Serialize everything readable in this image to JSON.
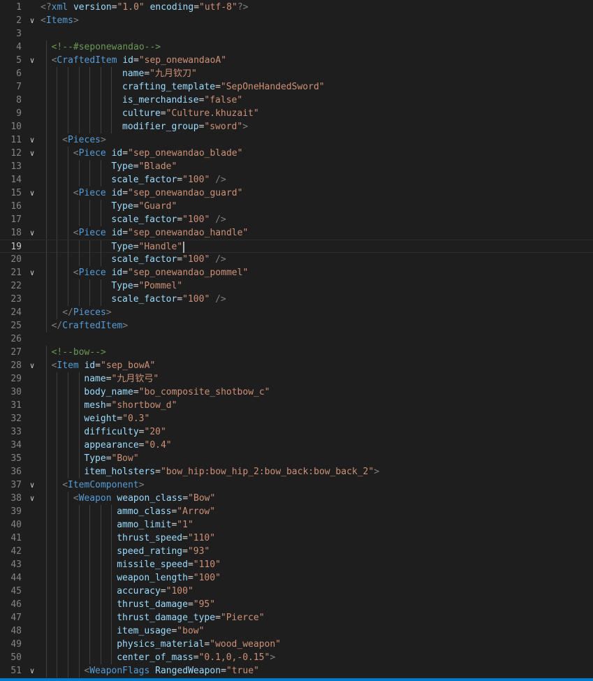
{
  "editor": {
    "current_line": 19,
    "colors": {
      "background": "#1e1e1e",
      "tag": "#569cd6",
      "bracket": "#808080",
      "attribute": "#9cdcfe",
      "string": "#ce9178",
      "comment": "#6a9955",
      "text": "#d4d4d4",
      "status_bar": "#007acc"
    },
    "lines": [
      {
        "n": "1",
        "fold": "",
        "indent": 0,
        "tokens": [
          [
            "b",
            "<?"
          ],
          [
            "t",
            "xml"
          ],
          [
            "s",
            " "
          ],
          [
            "a",
            "version"
          ],
          [
            "p",
            "="
          ],
          [
            "v",
            "\"1.0\""
          ],
          [
            "s",
            " "
          ],
          [
            "a",
            "encoding"
          ],
          [
            "p",
            "="
          ],
          [
            "v",
            "\"utf-8\""
          ],
          [
            "b",
            "?>"
          ]
        ]
      },
      {
        "n": "2",
        "fold": "v",
        "indent": 0,
        "tokens": [
          [
            "b",
            "<"
          ],
          [
            "t",
            "Items"
          ],
          [
            "b",
            ">"
          ]
        ]
      },
      {
        "n": "3",
        "fold": "",
        "indent": 0,
        "tokens": []
      },
      {
        "n": "4",
        "fold": "",
        "indent": 2,
        "tokens": [
          [
            "c",
            "<!--#seponewandao-->"
          ]
        ]
      },
      {
        "n": "5",
        "fold": "v",
        "indent": 2,
        "tokens": [
          [
            "b",
            "<"
          ],
          [
            "t",
            "CraftedItem"
          ],
          [
            "s",
            " "
          ],
          [
            "a",
            "id"
          ],
          [
            "p",
            "="
          ],
          [
            "v",
            "\"sep_onewandaoA\""
          ]
        ]
      },
      {
        "n": "6",
        "fold": "",
        "indent": 15,
        "tokens": [
          [
            "a",
            "name"
          ],
          [
            "p",
            "="
          ],
          [
            "v",
            "\"九月钦刀\""
          ]
        ]
      },
      {
        "n": "7",
        "fold": "",
        "indent": 15,
        "tokens": [
          [
            "a",
            "crafting_template"
          ],
          [
            "p",
            "="
          ],
          [
            "v",
            "\"SepOneHandedSword\""
          ]
        ]
      },
      {
        "n": "8",
        "fold": "",
        "indent": 15,
        "tokens": [
          [
            "a",
            "is_merchandise"
          ],
          [
            "p",
            "="
          ],
          [
            "v",
            "\"false\""
          ]
        ]
      },
      {
        "n": "9",
        "fold": "",
        "indent": 15,
        "tokens": [
          [
            "a",
            "culture"
          ],
          [
            "p",
            "="
          ],
          [
            "v",
            "\"Culture.khuzait\""
          ]
        ]
      },
      {
        "n": "10",
        "fold": "",
        "indent": 15,
        "tokens": [
          [
            "a",
            "modifier_group"
          ],
          [
            "p",
            "="
          ],
          [
            "v",
            "\"sword\""
          ],
          [
            "b",
            ">"
          ]
        ]
      },
      {
        "n": "11",
        "fold": "v",
        "indent": 4,
        "tokens": [
          [
            "b",
            "<"
          ],
          [
            "t",
            "Pieces"
          ],
          [
            "b",
            ">"
          ]
        ]
      },
      {
        "n": "12",
        "fold": "v",
        "indent": 6,
        "tokens": [
          [
            "b",
            "<"
          ],
          [
            "t",
            "Piece"
          ],
          [
            "s",
            " "
          ],
          [
            "a",
            "id"
          ],
          [
            "p",
            "="
          ],
          [
            "v",
            "\"sep_onewandao_blade\""
          ]
        ]
      },
      {
        "n": "13",
        "fold": "",
        "indent": 13,
        "tokens": [
          [
            "a",
            "Type"
          ],
          [
            "p",
            "="
          ],
          [
            "v",
            "\"Blade\""
          ]
        ]
      },
      {
        "n": "14",
        "fold": "",
        "indent": 13,
        "tokens": [
          [
            "a",
            "scale_factor"
          ],
          [
            "p",
            "="
          ],
          [
            "v",
            "\"100\""
          ],
          [
            "s",
            " "
          ],
          [
            "b",
            "/>"
          ]
        ]
      },
      {
        "n": "15",
        "fold": "v",
        "indent": 6,
        "tokens": [
          [
            "b",
            "<"
          ],
          [
            "t",
            "Piece"
          ],
          [
            "s",
            " "
          ],
          [
            "a",
            "id"
          ],
          [
            "p",
            "="
          ],
          [
            "v",
            "\"sep_onewandao_guard\""
          ]
        ]
      },
      {
        "n": "16",
        "fold": "",
        "indent": 13,
        "tokens": [
          [
            "a",
            "Type"
          ],
          [
            "p",
            "="
          ],
          [
            "v",
            "\"Guard\""
          ]
        ]
      },
      {
        "n": "17",
        "fold": "",
        "indent": 13,
        "tokens": [
          [
            "a",
            "scale_factor"
          ],
          [
            "p",
            "="
          ],
          [
            "v",
            "\"100\""
          ],
          [
            "s",
            " "
          ],
          [
            "b",
            "/>"
          ]
        ]
      },
      {
        "n": "18",
        "fold": "v",
        "indent": 6,
        "tokens": [
          [
            "b",
            "<"
          ],
          [
            "t",
            "Piece"
          ],
          [
            "s",
            " "
          ],
          [
            "a",
            "id"
          ],
          [
            "p",
            "="
          ],
          [
            "v",
            "\"sep_onewandao_handle\""
          ]
        ]
      },
      {
        "n": "19",
        "fold": "",
        "indent": 13,
        "tokens": [
          [
            "a",
            "Type"
          ],
          [
            "p",
            "="
          ],
          [
            "v",
            "\"Handle\""
          ]
        ],
        "cursor": true
      },
      {
        "n": "20",
        "fold": "",
        "indent": 13,
        "tokens": [
          [
            "a",
            "scale_factor"
          ],
          [
            "p",
            "="
          ],
          [
            "v",
            "\"100\""
          ],
          [
            "s",
            " "
          ],
          [
            "b",
            "/>"
          ]
        ]
      },
      {
        "n": "21",
        "fold": "v",
        "indent": 6,
        "tokens": [
          [
            "b",
            "<"
          ],
          [
            "t",
            "Piece"
          ],
          [
            "s",
            " "
          ],
          [
            "a",
            "id"
          ],
          [
            "p",
            "="
          ],
          [
            "v",
            "\"sep_onewandao_pommel\""
          ]
        ]
      },
      {
        "n": "22",
        "fold": "",
        "indent": 13,
        "tokens": [
          [
            "a",
            "Type"
          ],
          [
            "p",
            "="
          ],
          [
            "v",
            "\"Pommel\""
          ]
        ]
      },
      {
        "n": "23",
        "fold": "",
        "indent": 13,
        "tokens": [
          [
            "a",
            "scale_factor"
          ],
          [
            "p",
            "="
          ],
          [
            "v",
            "\"100\""
          ],
          [
            "s",
            " "
          ],
          [
            "b",
            "/>"
          ]
        ]
      },
      {
        "n": "24",
        "fold": "",
        "indent": 4,
        "tokens": [
          [
            "b",
            "</"
          ],
          [
            "t",
            "Pieces"
          ],
          [
            "b",
            ">"
          ]
        ]
      },
      {
        "n": "25",
        "fold": "",
        "indent": 2,
        "tokens": [
          [
            "b",
            "</"
          ],
          [
            "t",
            "CraftedItem"
          ],
          [
            "b",
            ">"
          ]
        ]
      },
      {
        "n": "26",
        "fold": "",
        "indent": 0,
        "tokens": []
      },
      {
        "n": "27",
        "fold": "",
        "indent": 2,
        "tokens": [
          [
            "c",
            "<!--bow-->"
          ]
        ]
      },
      {
        "n": "28",
        "fold": "v",
        "indent": 2,
        "tokens": [
          [
            "b",
            "<"
          ],
          [
            "t",
            "Item"
          ],
          [
            "s",
            " "
          ],
          [
            "a",
            "id"
          ],
          [
            "p",
            "="
          ],
          [
            "v",
            "\"sep_bowA\""
          ]
        ]
      },
      {
        "n": "29",
        "fold": "",
        "indent": 8,
        "tokens": [
          [
            "a",
            "name"
          ],
          [
            "p",
            "="
          ],
          [
            "v",
            "\"九月钦弓\""
          ]
        ]
      },
      {
        "n": "30",
        "fold": "",
        "indent": 8,
        "tokens": [
          [
            "a",
            "body_name"
          ],
          [
            "p",
            "="
          ],
          [
            "v",
            "\"bo_composite_shotbow_c\""
          ]
        ]
      },
      {
        "n": "31",
        "fold": "",
        "indent": 8,
        "tokens": [
          [
            "a",
            "mesh"
          ],
          [
            "p",
            "="
          ],
          [
            "v",
            "\"shortbow_d\""
          ]
        ]
      },
      {
        "n": "32",
        "fold": "",
        "indent": 8,
        "tokens": [
          [
            "a",
            "weight"
          ],
          [
            "p",
            "="
          ],
          [
            "v",
            "\"0.3\""
          ]
        ]
      },
      {
        "n": "33",
        "fold": "",
        "indent": 8,
        "tokens": [
          [
            "a",
            "difficulty"
          ],
          [
            "p",
            "="
          ],
          [
            "v",
            "\"20\""
          ]
        ]
      },
      {
        "n": "34",
        "fold": "",
        "indent": 8,
        "tokens": [
          [
            "a",
            "appearance"
          ],
          [
            "p",
            "="
          ],
          [
            "v",
            "\"0.4\""
          ]
        ]
      },
      {
        "n": "35",
        "fold": "",
        "indent": 8,
        "tokens": [
          [
            "a",
            "Type"
          ],
          [
            "p",
            "="
          ],
          [
            "v",
            "\"Bow\""
          ]
        ]
      },
      {
        "n": "36",
        "fold": "",
        "indent": 8,
        "tokens": [
          [
            "a",
            "item_holsters"
          ],
          [
            "p",
            "="
          ],
          [
            "v",
            "\"bow_hip:bow_hip_2:bow_back:bow_back_2\""
          ],
          [
            "b",
            ">"
          ]
        ]
      },
      {
        "n": "37",
        "fold": "v",
        "indent": 4,
        "tokens": [
          [
            "b",
            "<"
          ],
          [
            "t",
            "ItemComponent"
          ],
          [
            "b",
            ">"
          ]
        ]
      },
      {
        "n": "38",
        "fold": "v",
        "indent": 6,
        "tokens": [
          [
            "b",
            "<"
          ],
          [
            "t",
            "Weapon"
          ],
          [
            "s",
            " "
          ],
          [
            "a",
            "weapon_class"
          ],
          [
            "p",
            "="
          ],
          [
            "v",
            "\"Bow\""
          ]
        ]
      },
      {
        "n": "39",
        "fold": "",
        "indent": 14,
        "tokens": [
          [
            "a",
            "ammo_class"
          ],
          [
            "p",
            "="
          ],
          [
            "v",
            "\"Arrow\""
          ]
        ]
      },
      {
        "n": "40",
        "fold": "",
        "indent": 14,
        "tokens": [
          [
            "a",
            "ammo_limit"
          ],
          [
            "p",
            "="
          ],
          [
            "v",
            "\"1\""
          ]
        ]
      },
      {
        "n": "41",
        "fold": "",
        "indent": 14,
        "tokens": [
          [
            "a",
            "thrust_speed"
          ],
          [
            "p",
            "="
          ],
          [
            "v",
            "\"110\""
          ]
        ]
      },
      {
        "n": "42",
        "fold": "",
        "indent": 14,
        "tokens": [
          [
            "a",
            "speed_rating"
          ],
          [
            "p",
            "="
          ],
          [
            "v",
            "\"93\""
          ]
        ]
      },
      {
        "n": "43",
        "fold": "",
        "indent": 14,
        "tokens": [
          [
            "a",
            "missile_speed"
          ],
          [
            "p",
            "="
          ],
          [
            "v",
            "\"110\""
          ]
        ]
      },
      {
        "n": "44",
        "fold": "",
        "indent": 14,
        "tokens": [
          [
            "a",
            "weapon_length"
          ],
          [
            "p",
            "="
          ],
          [
            "v",
            "\"100\""
          ]
        ]
      },
      {
        "n": "45",
        "fold": "",
        "indent": 14,
        "tokens": [
          [
            "a",
            "accuracy"
          ],
          [
            "p",
            "="
          ],
          [
            "v",
            "\"100\""
          ]
        ]
      },
      {
        "n": "46",
        "fold": "",
        "indent": 14,
        "tokens": [
          [
            "a",
            "thrust_damage"
          ],
          [
            "p",
            "="
          ],
          [
            "v",
            "\"95\""
          ]
        ]
      },
      {
        "n": "47",
        "fold": "",
        "indent": 14,
        "tokens": [
          [
            "a",
            "thrust_damage_type"
          ],
          [
            "p",
            "="
          ],
          [
            "v",
            "\"Pierce\""
          ]
        ]
      },
      {
        "n": "48",
        "fold": "",
        "indent": 14,
        "tokens": [
          [
            "a",
            "item_usage"
          ],
          [
            "p",
            "="
          ],
          [
            "v",
            "\"bow\""
          ]
        ]
      },
      {
        "n": "49",
        "fold": "",
        "indent": 14,
        "tokens": [
          [
            "a",
            "physics_material"
          ],
          [
            "p",
            "="
          ],
          [
            "v",
            "\"wood_weapon\""
          ]
        ]
      },
      {
        "n": "50",
        "fold": "",
        "indent": 14,
        "tokens": [
          [
            "a",
            "center_of_mass"
          ],
          [
            "p",
            "="
          ],
          [
            "v",
            "\"0.1,0,-0.15\""
          ],
          [
            "b",
            ">"
          ]
        ]
      },
      {
        "n": "51",
        "fold": "v",
        "indent": 8,
        "tokens": [
          [
            "b",
            "<"
          ],
          [
            "t",
            "WeaponFlags"
          ],
          [
            "s",
            " "
          ],
          [
            "a",
            "RangedWeapon"
          ],
          [
            "p",
            "="
          ],
          [
            "v",
            "\"true\""
          ]
        ]
      }
    ]
  }
}
